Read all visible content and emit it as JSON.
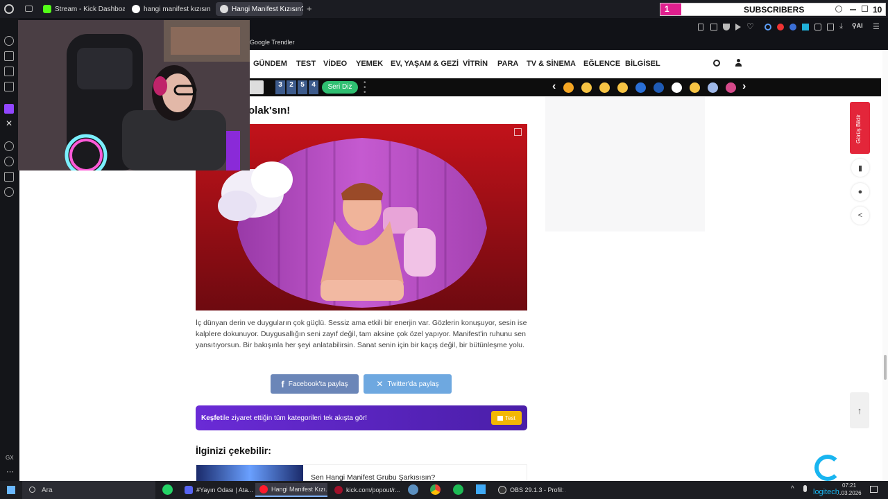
{
  "browser": {
    "tabs": [
      {
        "label": "Stream - Kick Dashboard",
        "icon": "kick-icon"
      },
      {
        "label": "hangi manifest kızısın - Go",
        "icon": "google-icon"
      },
      {
        "label": "Hangi Manifest Kızısın? - O",
        "icon": "onedio-icon"
      }
    ],
    "new_tab": "+",
    "bookmark": "Google Trendler"
  },
  "overlay": {
    "subscriber_count": "1",
    "subscriber_label": "SUBSCRIBERS",
    "top_right_number": "10"
  },
  "site": {
    "nav": [
      "GÜNDEM",
      "TEST",
      "VİDEO",
      "YEMEK",
      "EV, YAŞAM & GEZİ",
      "VİTRİN",
      "PARA",
      "TV & SİNEMA",
      "EĞLENCE",
      "BİLGİSEL"
    ],
    "strip": {
      "digits": [
        "3",
        "2",
        "5",
        "4"
      ],
      "series_button": "Seri Diz",
      "prev": "‹",
      "next": "›"
    },
    "article": {
      "heading": "olak'sın!",
      "paragraph": "İç dünyan derin ve duyguların çok güçlü. Sessiz ama etkili bir enerjin var. Gözlerin konuşuyor, sesin ise kalplere dokunuyor. Duygusallığın seni zayıf değil, tam aksine çok özel yapıyor. Manifest'in ruhunu sen yansıtıyorsun. Bir bakışınla her şeyi anlatabilirsin. Sanat senin için bir kaçış değil, bir bütünleşme yolu.",
      "share_facebook": "Facebook'ta paylaş",
      "share_twitter": "Twitter'da paylaş",
      "discover_bold": "Keşfet",
      "discover_text": " ile ziyaret ettiğin tüm kategorileri tek akışta gör!",
      "discover_button": "Test",
      "related_heading": "İlginizi çekebilir:",
      "related_title": "Sen Hangi Manifest Grubu Şarkısısın?"
    },
    "feedback_label": "Görüş Bildir"
  },
  "taskbar": {
    "search_placeholder": "Ara",
    "items": [
      {
        "label": "#Yayın Odası | Ata...",
        "icon": "discord-icon"
      },
      {
        "label": "Hangi Manifest Kızı...",
        "icon": "opera-icon"
      },
      {
        "label": "kick.com/popout/r...",
        "icon": "opera-gx-icon"
      },
      {
        "label": "OBS 29.1.3 - Profil: ...",
        "icon": "obs-icon"
      }
    ],
    "time": "07:21",
    "date": "...03.2026",
    "logi": "logitech"
  },
  "colors": {
    "kick": "#53fc18",
    "facebook": "#6b86b8",
    "twitter": "#6ea8e0",
    "discover": "#5a25c0",
    "feedback": "#e3263a",
    "subs_pink": "#e01f8e"
  }
}
